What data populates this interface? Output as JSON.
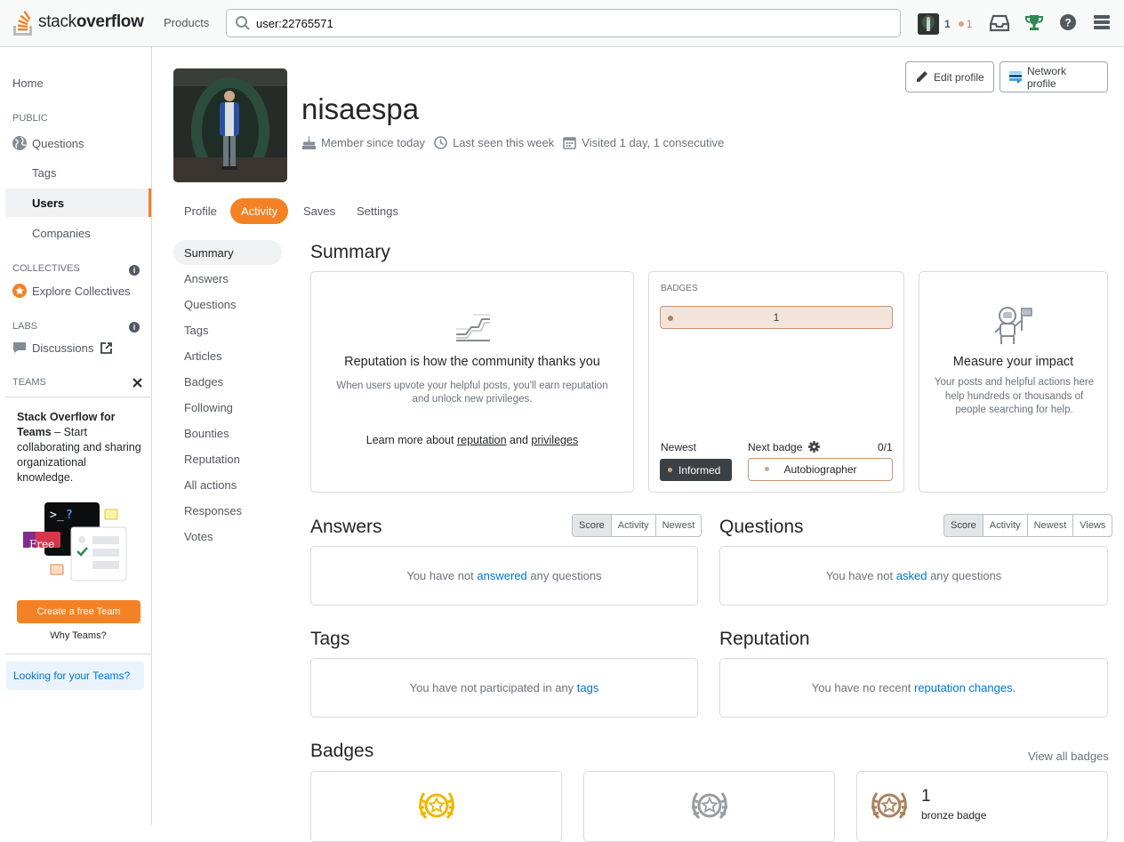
{
  "topbar": {
    "logo_text_light": "stack",
    "logo_text_bold": "overflow",
    "products": "Products",
    "search_value": "user:22765571",
    "reputation": "1",
    "bronze_count": "1"
  },
  "leftnav": {
    "home": "Home",
    "public_label": "PUBLIC",
    "questions": "Questions",
    "tags": "Tags",
    "users": "Users",
    "companies": "Companies",
    "collectives_label": "COLLECTIVES",
    "explore_collectives": "Explore Collectives",
    "labs_label": "LABS",
    "discussions": "Discussions",
    "teams_label": "TEAMS",
    "teams_title_bold": "Stack Overflow for Teams",
    "teams_title_rest": " – Start collaborating and sharing organizational knowledge.",
    "free_badge": "Free",
    "teams_button": "Create a free Team",
    "why_teams": "Why Teams?",
    "looking_for_teams": "Looking for your Teams?"
  },
  "profile": {
    "username": "nisaespa",
    "member_since": "Member since today",
    "last_seen": "Last seen this week",
    "visited": "Visited 1 day, 1 consecutive",
    "edit_profile": "Edit profile",
    "network_profile": "Network profile"
  },
  "tabs": [
    "Profile",
    "Activity",
    "Saves",
    "Settings"
  ],
  "activity_nav": [
    "Summary",
    "Answers",
    "Questions",
    "Tags",
    "Articles",
    "Badges",
    "Following",
    "Bounties",
    "Reputation",
    "All actions",
    "Responses",
    "Votes"
  ],
  "summary": {
    "title": "Summary",
    "reputation_card": {
      "heading": "Reputation is how the community thanks you",
      "body": "When users upvote your helpful posts, you'll earn reputation and unlock new privileges.",
      "learn_prefix": "Learn more about",
      "reputation_link": "reputation",
      "and": "and",
      "privileges_link": "privileges"
    },
    "badges_card": {
      "label": "BADGES",
      "bronze_total": "1",
      "newest_label": "Newest",
      "newest_badge": "Informed",
      "next_badge_label": "Next badge",
      "next_progress": "0/1",
      "next_badge": "Autobiographer"
    },
    "impact_card": {
      "heading": "Measure your impact",
      "body": "Your posts and helpful actions here help hundreds or thousands of people searching for help."
    }
  },
  "answers": {
    "title": "Answers",
    "sort": [
      "Score",
      "Activity",
      "Newest"
    ],
    "empty_prefix": "You have not",
    "empty_link": "answered",
    "empty_suffix": "any questions"
  },
  "questions": {
    "title": "Questions",
    "sort": [
      "Score",
      "Activity",
      "Newest",
      "Views"
    ],
    "empty_prefix": "You have not",
    "empty_link": "asked",
    "empty_suffix": "any questions"
  },
  "tags_section": {
    "title": "Tags",
    "empty_prefix": "You have not participated in any",
    "empty_link": "tags"
  },
  "reputation_section": {
    "title": "Reputation",
    "empty_prefix": "You have no recent",
    "empty_link": "reputation changes."
  },
  "badges_section": {
    "title": "Badges",
    "view_all": "View all badges",
    "bronze_count": "1",
    "bronze_label": "bronze badge"
  },
  "colors": {
    "accent": "#f48225",
    "link": "#0074cc",
    "gold": "#f1b600",
    "silver": "#9a9c9f",
    "bronze": "#ab825f"
  }
}
